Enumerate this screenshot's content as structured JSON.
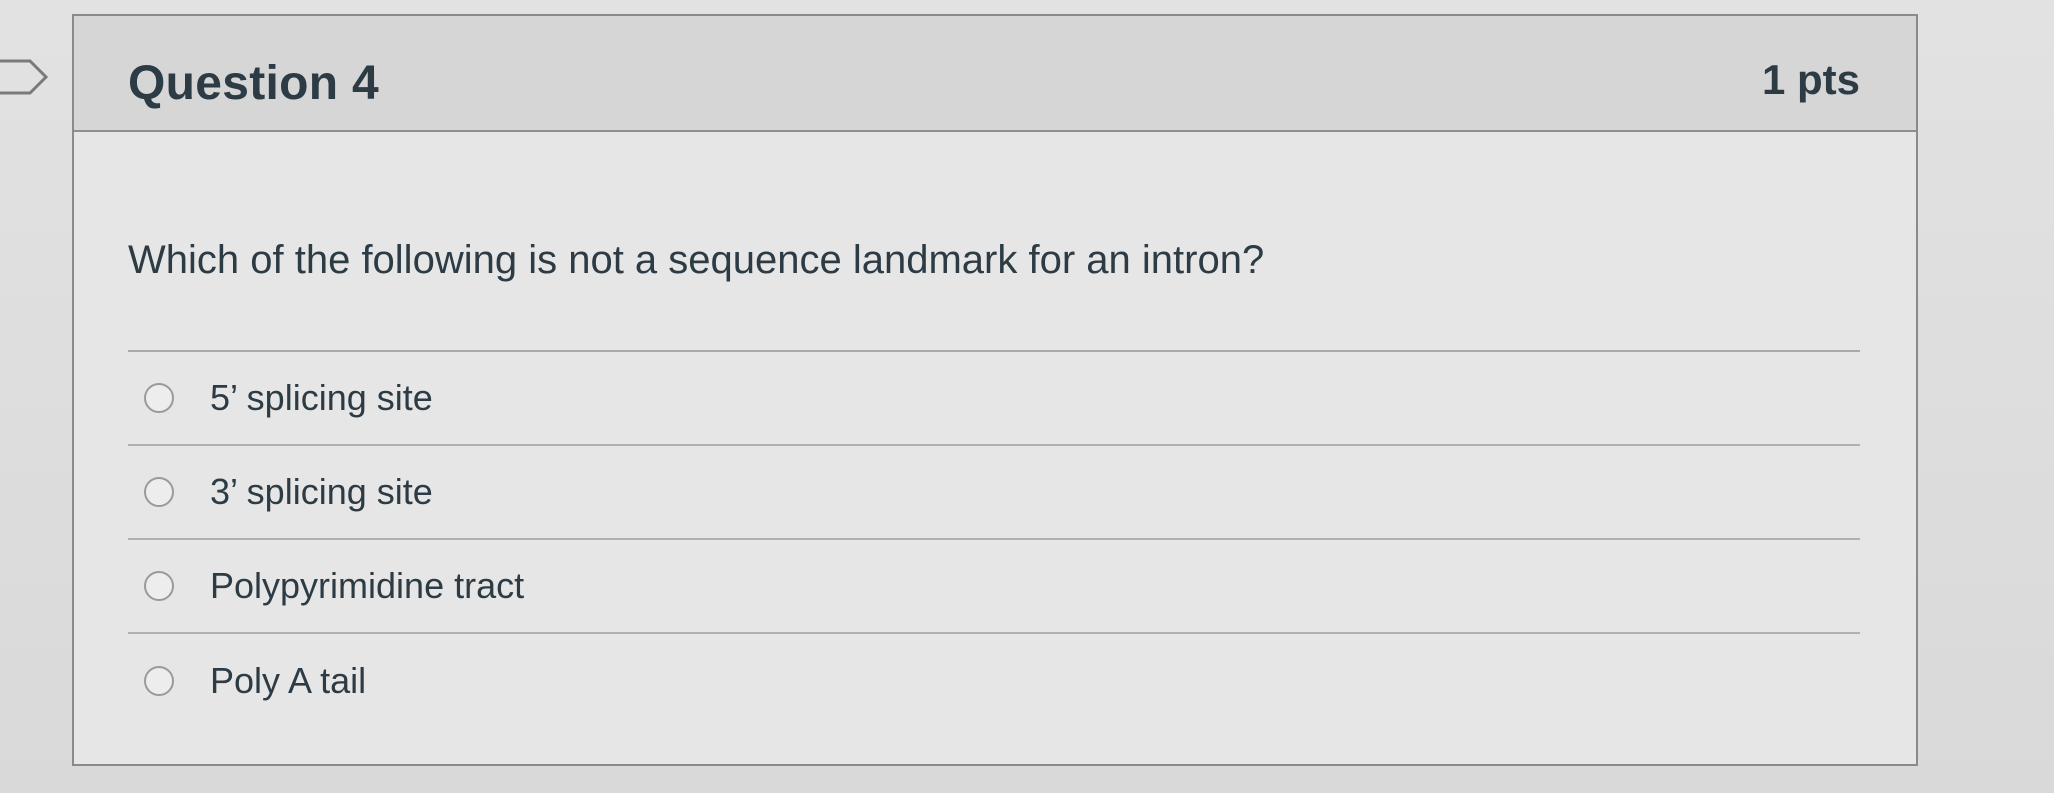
{
  "question": {
    "title": "Question 4",
    "points": "1 pts",
    "text": "Which of the following is not a sequence landmark for an intron?",
    "answers": [
      {
        "label": "5’ splicing site",
        "selected": false
      },
      {
        "label": "3’ splicing site",
        "selected": false
      },
      {
        "label": "Polypyrimidine tract",
        "selected": false
      },
      {
        "label": "Poly A tail",
        "selected": false
      }
    ]
  },
  "icons": {
    "flag": "flag-icon",
    "radio": "radio-button"
  }
}
